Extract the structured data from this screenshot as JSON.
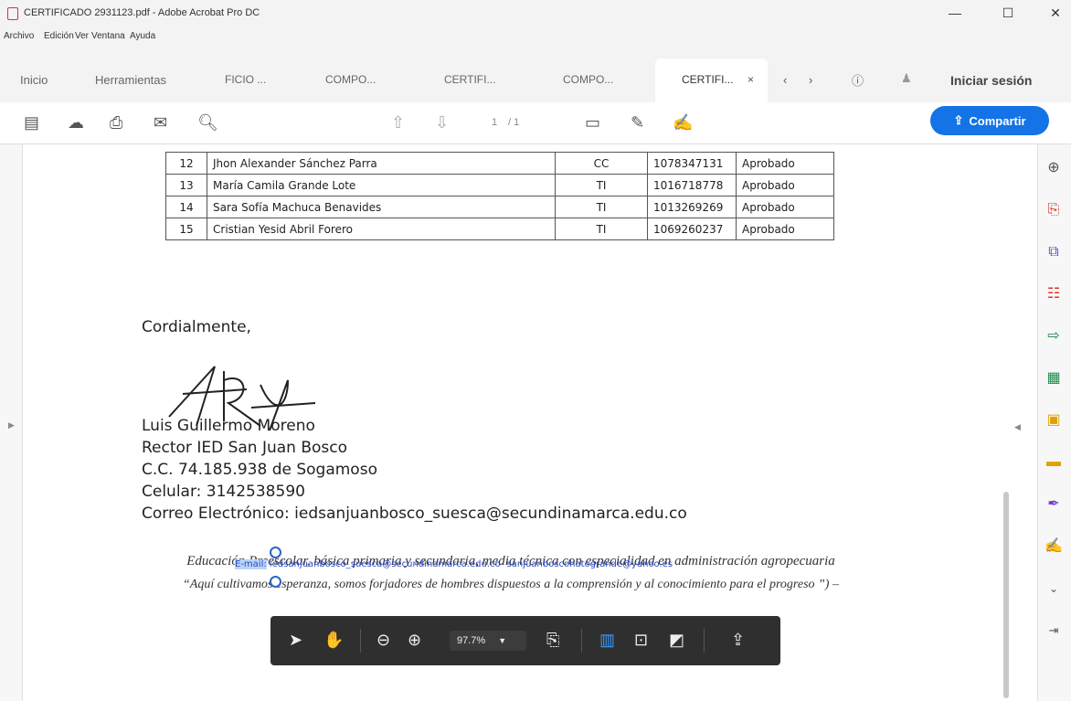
{
  "window": {
    "title": "CERTIFICADO 2931123.pdf - Adobe Acrobat Pro DC",
    "minimize": "—",
    "maximize": "☐",
    "close": "✕"
  },
  "menu": [
    "Archivo",
    "Edición",
    "Ver",
    "Ventana",
    "Ayuda"
  ],
  "tabs": {
    "home": "Inicio",
    "tools": "Herramientas",
    "docs": [
      "FICIO ...",
      "COMPO...",
      "CERTIFI...",
      "COMPO...",
      "CERTIFI..."
    ],
    "close_glyph": "×",
    "signin": "Iniciar sesión"
  },
  "toolbar": {
    "page_current": "1",
    "page_total": "/ 1",
    "share_label": "Compartir"
  },
  "table": {
    "rows": [
      [
        "12",
        "Jhon Alexander Sánchez Parra",
        "CC",
        "1078347131",
        "Aprobado"
      ],
      [
        "13",
        "María Camila Grande Lote",
        "TI",
        "1016718778",
        "Aprobado"
      ],
      [
        "14",
        "Sara Sofía Machuca Benavides",
        "TI",
        "1013269269",
        "Aprobado"
      ],
      [
        "15",
        "Cristian Yesid Abril Forero",
        "TI",
        "1069260237",
        "Aprobado"
      ]
    ]
  },
  "letter": {
    "closing": "Cordialmente,",
    "name": "Luis Guillermo Moreno",
    "role": "Rector IED San Juan Bosco",
    "id": "C.C.  74.185.938 de Sogamoso",
    "phone": "Celular: 3142538590",
    "email": "Correo Electrónico: iedsanjuanbosco_suesca@secundinamarca.edu.co"
  },
  "footer": {
    "line1": "Educación Preescolar, básica primaria y secundaria, media técnica con especialidad en administración agropecuaria",
    "line2": "“Aquí cultivamos esperanza, somos forjadores de hombres dispuestos a la comprensión y al conocimiento para el progreso ”) –",
    "email_prefix": "E-mail:",
    "email_rest": " iedsanjuanbosco_suesca@secundinamarca.edu.co- sanjuanboscohatogrande@yahoo.es"
  },
  "floating_toolbar": {
    "zoom": "97.7%"
  },
  "colors": {
    "accent": "#1473e6",
    "selected_tool": "#3b9cff",
    "pdf_red": "#d9342b"
  }
}
